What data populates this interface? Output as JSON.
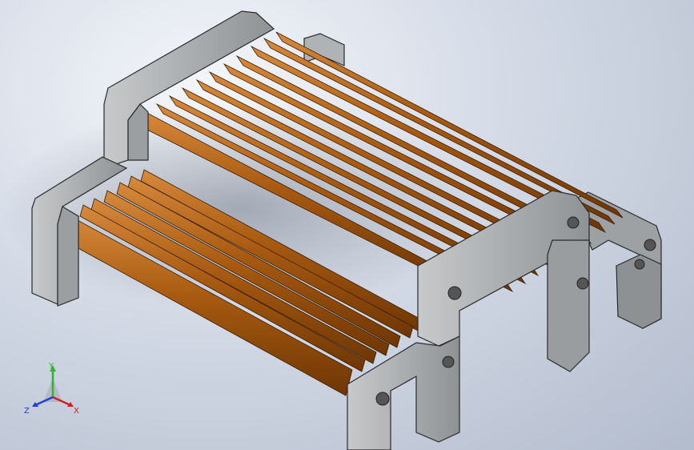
{
  "viewport": {
    "background": "#c6cdd9",
    "frame_color": "#a9acae",
    "frame_edge_color": "#2a2a2a",
    "slat_color": "#a85a10",
    "slat_highlight": "#d78a3c"
  },
  "triad": {
    "x_label": "X",
    "y_label": "Y",
    "z_label": "Z",
    "x_color": "#d62020",
    "y_color": "#2fb52f",
    "z_color": "#2440d0"
  }
}
